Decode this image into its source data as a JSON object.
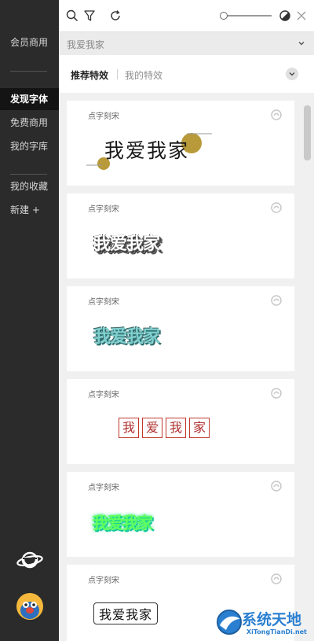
{
  "sidebar": {
    "items": [
      {
        "label": "会员商用"
      },
      {
        "label": "发现字体"
      },
      {
        "label": "免费商用"
      },
      {
        "label": "我的字库"
      },
      {
        "label": "我的收藏"
      },
      {
        "label": "新建 +"
      }
    ],
    "active_index": 1
  },
  "search": {
    "text": "我爱我家"
  },
  "tabs": {
    "active": "推荐特效",
    "other": "我的特效"
  },
  "fonts": [
    {
      "label": "点字刻宋",
      "preview": "我爱我家"
    },
    {
      "label": "点字刻宋",
      "preview": "我爱我家"
    },
    {
      "label": "点字刻宋",
      "preview": "我爱我家"
    },
    {
      "label": "点字刻宋",
      "preview_chars": [
        "我",
        "爱",
        "我",
        "家"
      ]
    },
    {
      "label": "点字刻宋",
      "preview": "我爱我家"
    },
    {
      "label": "点字刻宋",
      "preview": "我爱我家"
    }
  ],
  "watermark": {
    "title": "系统天地",
    "subtitle": "XiTongTianDi.net"
  },
  "colors": {
    "sidebar_bg": "#2b2b2b",
    "active_bg": "#141414",
    "accent_watermark": "#2a7fd0"
  }
}
